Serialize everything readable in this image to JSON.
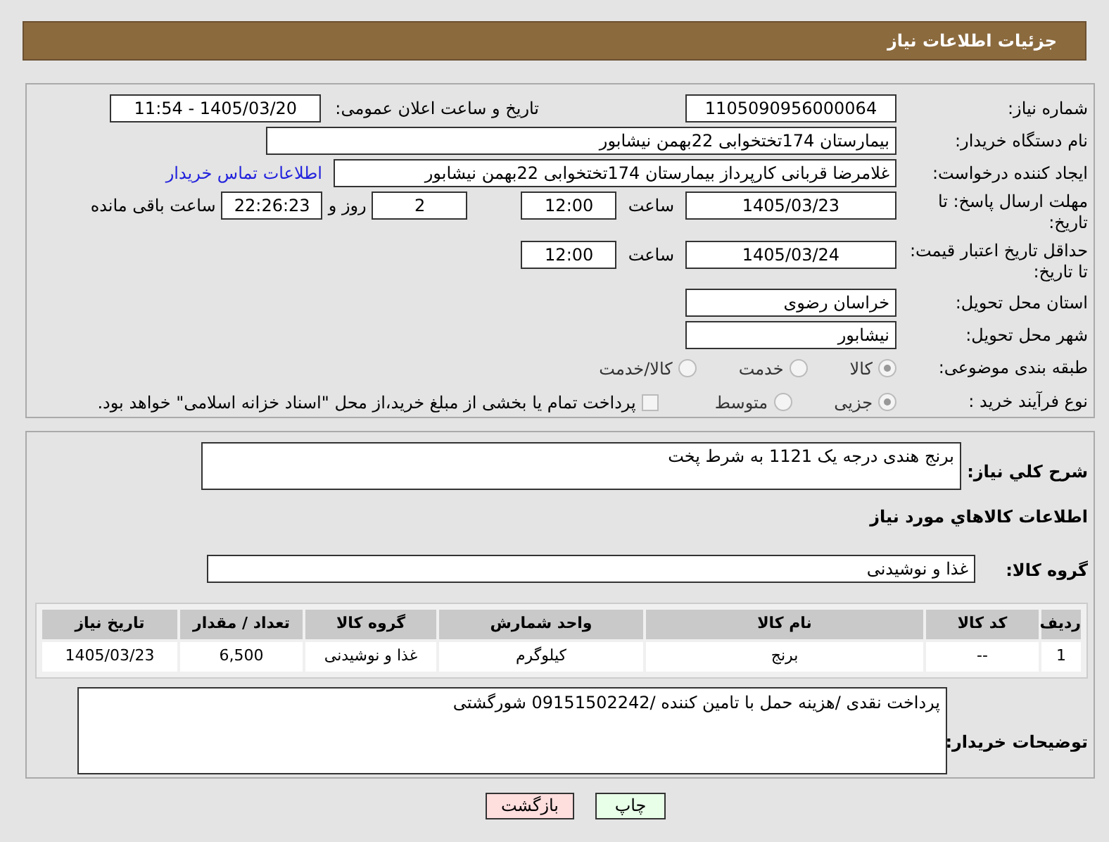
{
  "header": {
    "title": "جزئیات اطلاعات نیاز"
  },
  "need_number": {
    "label": "شماره نیاز:",
    "value": "1105090956000064"
  },
  "announce": {
    "label": "تاریخ و ساعت اعلان عمومی:",
    "value": "1405/03/20 - 11:54"
  },
  "buyer_org": {
    "label": "نام دستگاه خریدار:",
    "value": "بیمارستان 174تختخوابی 22بهمن نیشابور"
  },
  "requester": {
    "label": "ایجاد کننده درخواست:",
    "value": "غلامرضا قربانی کارپرداز بیمارستان 174تختخوابی 22بهمن نیشابور",
    "link": "اطلاعات تماس خریدار"
  },
  "reply_deadline": {
    "label": "مهلت ارسال پاسخ: تا تاریخ:",
    "date": "1405/03/23",
    "time_label": "ساعت",
    "time": "12:00",
    "days": "2",
    "days_label": "روز و",
    "remaining": "22:26:23",
    "remaining_label": "ساعت باقی مانده"
  },
  "price_validity": {
    "label": "حداقل تاریخ اعتبار قیمت: تا تاریخ:",
    "date": "1405/03/24",
    "time_label": "ساعت",
    "time": "12:00"
  },
  "province": {
    "label": "استان محل تحویل:",
    "value": "خراسان رضوی"
  },
  "city": {
    "label": "شهر محل تحویل:",
    "value": "نیشابور"
  },
  "category": {
    "label": "طبقه بندی موضوعی:",
    "options": [
      {
        "label": "کالا",
        "selected": true
      },
      {
        "label": "خدمت",
        "selected": false
      },
      {
        "label": "کالا/خدمت",
        "selected": false
      }
    ]
  },
  "purchase_type": {
    "label": "نوع فرآیند خرید :",
    "options": [
      {
        "label": "جزیی",
        "selected": true
      },
      {
        "label": "متوسط",
        "selected": false
      }
    ],
    "treasury": {
      "checked": false,
      "label": "پرداخت تمام یا بخشی از مبلغ خرید،از محل \"اسناد خزانه اسلامی\" خواهد بود."
    }
  },
  "description": {
    "label": "شرح کلي نياز:",
    "value": "برنج هندی درجه یک 1121 به شرط پخت"
  },
  "goods_title": "اطلاعات کالاهاي مورد نياز",
  "goods_group": {
    "label": "گروه کالا:",
    "value": "غذا و نوشیدنی"
  },
  "table": {
    "columns": [
      "ردیف",
      "کد کالا",
      "نام کالا",
      "واحد شمارش",
      "گروه کالا",
      "تعداد / مقدار",
      "تاریخ نیاز"
    ],
    "rows": [
      [
        "1",
        "--",
        "برنج",
        "کیلوگرم",
        "غذا و نوشیدنی",
        "6,500",
        "1405/03/23"
      ]
    ]
  },
  "notes": {
    "label": "توضیحات خریدار:",
    "value": "پرداخت نقدی /هزینه حمل با تامین کننده /09151502242 شورگشتی"
  },
  "buttons": [
    {
      "label": "چاپ",
      "kind": "print"
    },
    {
      "label": "بازگشت",
      "kind": "back"
    }
  ]
}
